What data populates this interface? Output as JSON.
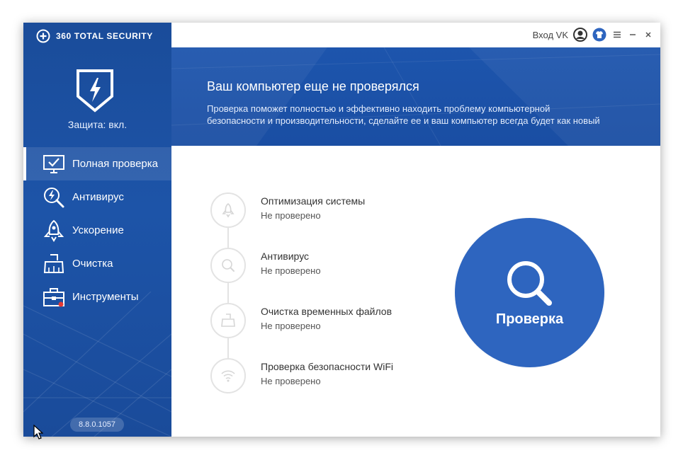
{
  "app": {
    "brand": "360 TOTAL SECURITY",
    "protection_status": "Защита: вкл.",
    "version": "8.8.0.1057"
  },
  "colors": {
    "sidebar": "#1d54a8",
    "banner": "#1d55ad",
    "accent": "#2e65bf",
    "notification_dot": "#e53935"
  },
  "sidebar": {
    "items": [
      {
        "label": "Полная проверка",
        "icon": "monitor-check-icon",
        "active": true
      },
      {
        "label": "Антивирус",
        "icon": "magnifier-bolt-icon"
      },
      {
        "label": "Ускорение",
        "icon": "rocket-icon"
      },
      {
        "label": "Очистка",
        "icon": "broom-icon"
      },
      {
        "label": "Инструменты",
        "icon": "toolbox-icon",
        "badge": true
      }
    ]
  },
  "topbar": {
    "login": "Вход VK"
  },
  "banner": {
    "title": "Ваш компьютер еще не проверялся",
    "description": "Проверка поможет полностью и эффективно находить проблему компьютерной безопасности и производительности, сделайте ее и ваш компьютер всегда будет как новый"
  },
  "checks": [
    {
      "title": "Оптимизация системы",
      "status": "Не проверено",
      "icon": "rocket-icon"
    },
    {
      "title": "Антивирус",
      "status": "Не проверено",
      "icon": "search-icon"
    },
    {
      "title": "Очистка временных файлов",
      "status": "Не проверено",
      "icon": "broom-icon"
    },
    {
      "title": "Проверка безопасности WiFi",
      "status": "Не проверено",
      "icon": "wifi-icon"
    }
  ],
  "scan": {
    "label": "Проверка"
  }
}
